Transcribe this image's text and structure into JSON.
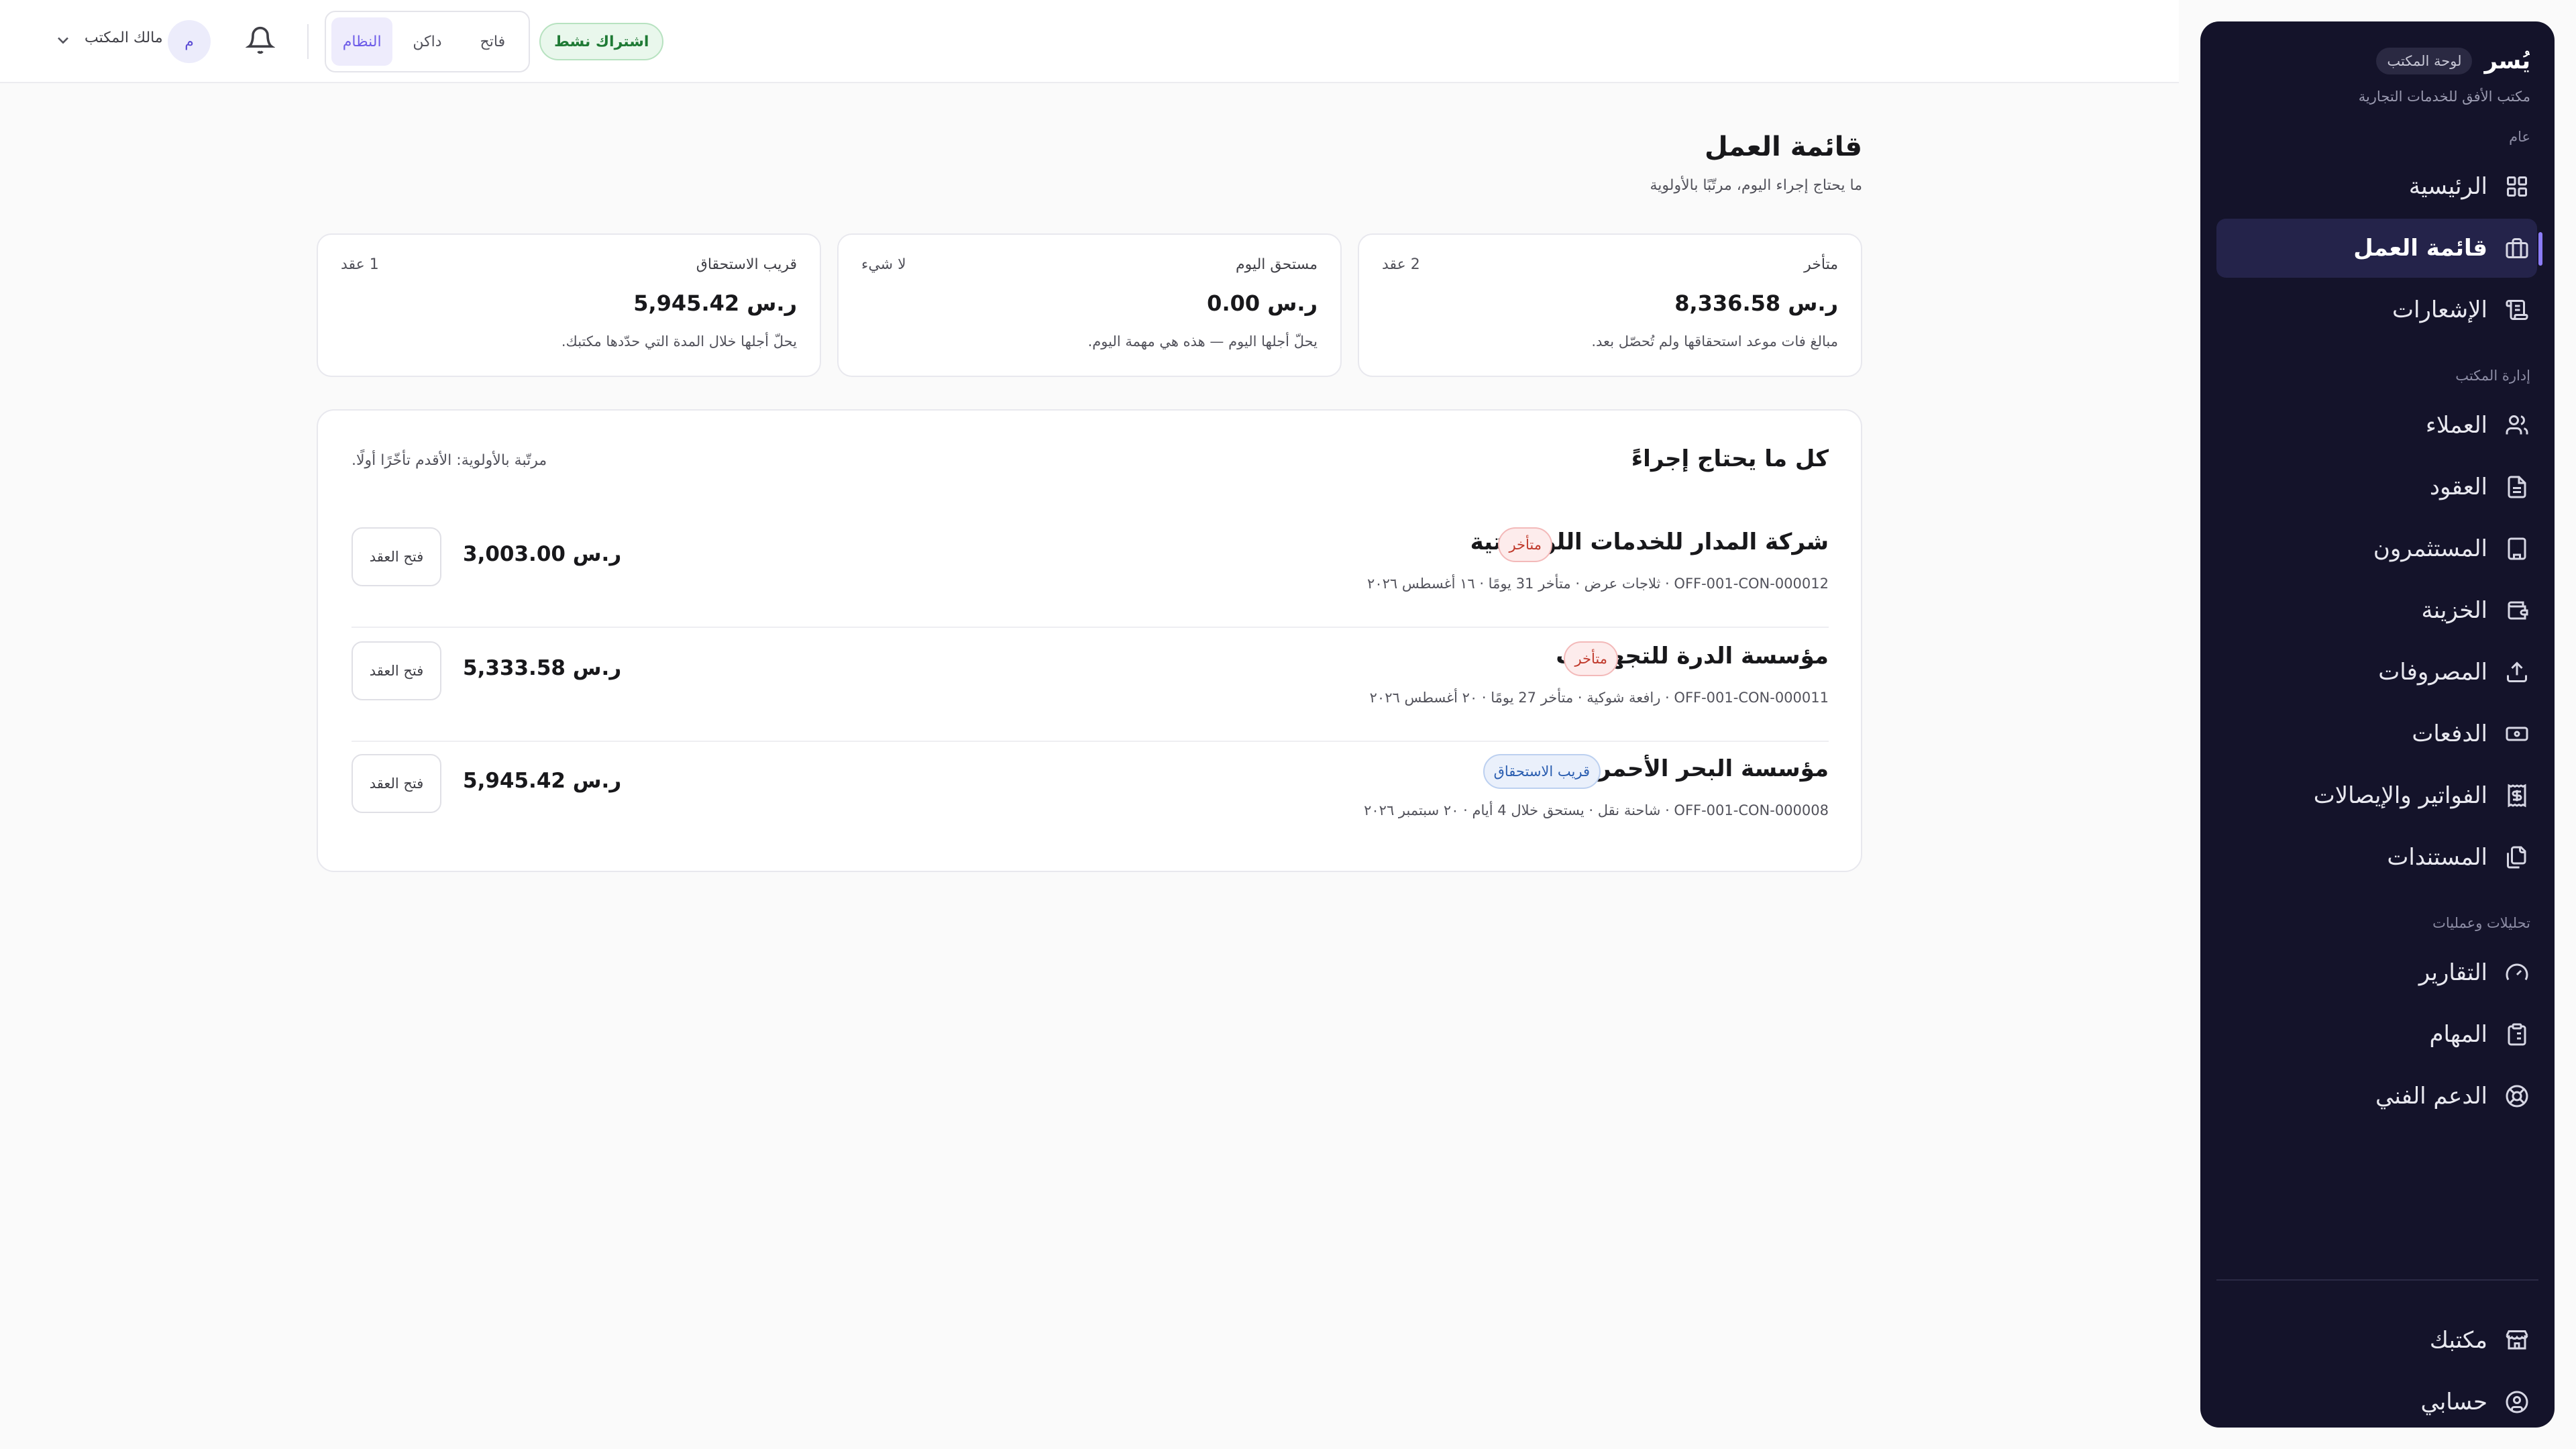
{
  "sidebar": {
    "brand": "يُسر",
    "brand_chip": "لوحة المكتب",
    "office_name": "مكتب الأفق للخدمات التجارية",
    "sections": {
      "general": "عام",
      "office_admin": "إدارة المكتب",
      "analytics": "تحليلات وعمليات"
    },
    "items": [
      {
        "label": "الرئيسية",
        "icon": "grid-icon"
      },
      {
        "label": "قائمة العمل",
        "icon": "briefcase-icon",
        "active": true
      },
      {
        "label": "الإشعارات",
        "icon": "notes-icon"
      },
      {
        "label": "العملاء",
        "icon": "users-icon"
      },
      {
        "label": "العقود",
        "icon": "file-text-icon"
      },
      {
        "label": "المستثمرون",
        "icon": "building-icon"
      },
      {
        "label": "الخزينة",
        "icon": "wallet-icon"
      },
      {
        "label": "المصروفات",
        "icon": "upload-icon"
      },
      {
        "label": "الدفعات",
        "icon": "banknote-icon"
      },
      {
        "label": "الفواتير والإيصالات",
        "icon": "receipt-icon"
      },
      {
        "label": "المستندات",
        "icon": "files-icon"
      },
      {
        "label": "التقارير",
        "icon": "gauge-icon"
      },
      {
        "label": "المهام",
        "icon": "clipboard-icon"
      },
      {
        "label": "الدعم الفني",
        "icon": "lifebuoy-icon"
      }
    ],
    "bottom_items": [
      {
        "label": "مكتبك",
        "icon": "store-icon"
      },
      {
        "label": "حسابي",
        "icon": "user-circle-icon"
      }
    ]
  },
  "topbar": {
    "status": "اشتراك نشط",
    "roles": [
      "فاتح",
      "داكن",
      "النظام"
    ],
    "active_role": "النظام",
    "avatar_initial": "م",
    "account_name": "مالك المكتب"
  },
  "page": {
    "title": "قائمة العمل",
    "subtitle": "ما يحتاج إجراء اليوم، مرتّبًا بالأولوية"
  },
  "stats": [
    {
      "label": "متأخر",
      "count": "2 عقد",
      "amount": "ر.س 8,336.58",
      "desc": "مبالغ فات موعد استحقاقها ولم تُحصّل بعد."
    },
    {
      "label": "مستحق اليوم",
      "count": "لا شيء",
      "amount": "ر.س 0.00",
      "desc": "يحلّ أجلها اليوم — هذه هي مهمة اليوم."
    },
    {
      "label": "قريب الاستحقاق",
      "count": "1 عقد",
      "amount": "ر.س 5,945.42",
      "desc": "يحلّ أجلها خلال المدة التي حدّدها مكتبك."
    }
  ],
  "list": {
    "title": "كل ما يحتاج إجراءً",
    "hint": "مرتّبة بالأولوية: الأقدم تأخّرًا أولًا.",
    "button_label": "فتح العقد",
    "rows": [
      {
        "name": "شركة المدار للخدمات اللوجستية",
        "badge": "متأخر",
        "badge_type": "late",
        "meta": "OFF-001-CON-000012 · ثلاجات عرض · متأخر 31 يومًا · ١٦ أغسطس ٢٠٢٦",
        "amount": "ر.س 3,003.00"
      },
      {
        "name": "مؤسسة الدرة للتجهيزات",
        "badge": "متأخر",
        "badge_type": "late",
        "meta": "OFF-001-CON-000011 · رافعة شوكية · متأخر 27 يومًا · ٢٠ أغسطس ٢٠٢٦",
        "amount": "ر.س 5,333.58"
      },
      {
        "name": "مؤسسة البحر الأحمر للنقل",
        "badge": "قريب الاستحقاق",
        "badge_type": "soon",
        "meta": "OFF-001-CON-000008 · شاحنة نقل · يستحق خلال 4 أيام · ٢٠ سبتمبر ٢٠٢٦",
        "amount": "ر.س 5,945.42"
      }
    ]
  }
}
